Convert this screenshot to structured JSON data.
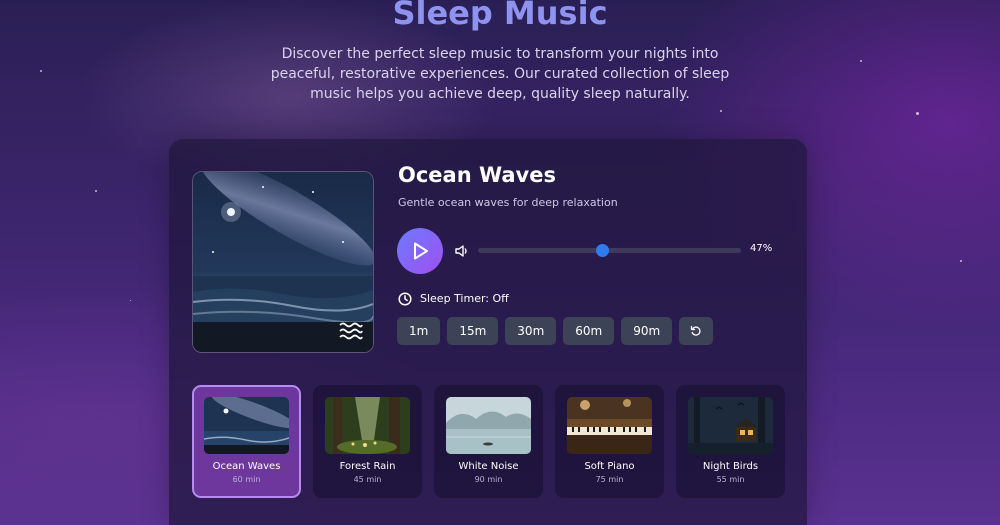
{
  "header": {
    "title": "Sleep Music",
    "subtitle": "Discover the perfect sleep music to transform your nights into peaceful, restorative experiences. Our curated collection of sleep music helps you achieve deep, quality sleep naturally."
  },
  "player": {
    "current_title": "Ocean Waves",
    "current_description": "Gentle ocean waves for deep relaxation",
    "volume_percent": 47,
    "volume_label": "47%",
    "timer_label": "Sleep Timer: Off",
    "timer_options": [
      "1m",
      "15m",
      "30m",
      "60m",
      "90m"
    ],
    "artwork_icon": "waves-icon",
    "play_icon": "play-icon",
    "volume_icon": "volume-icon",
    "timer_icon": "clock-icon",
    "reset_icon": "reset-icon"
  },
  "tracks": [
    {
      "name": "Ocean Waves",
      "duration": "60 min",
      "active": true
    },
    {
      "name": "Forest Rain",
      "duration": "45 min",
      "active": false
    },
    {
      "name": "White Noise",
      "duration": "90 min",
      "active": false
    },
    {
      "name": "Soft Piano",
      "duration": "75 min",
      "active": false
    },
    {
      "name": "Night Birds",
      "duration": "55 min",
      "active": false
    }
  ],
  "colors": {
    "title": "#8f93f0",
    "accent_start": "#6a7bff",
    "accent_end": "#a04ff0",
    "volume_thumb": "#2f7bf0",
    "active_track": "#b58cf0"
  }
}
